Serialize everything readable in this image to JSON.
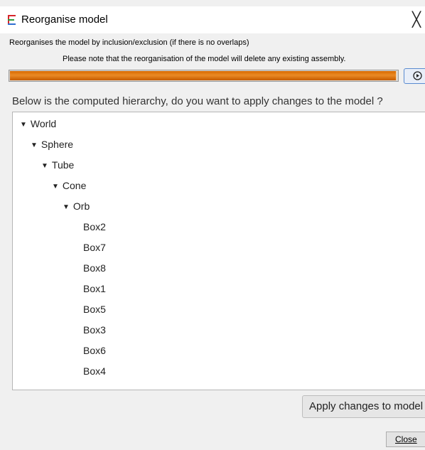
{
  "window": {
    "title": "Reorganise model",
    "close_glyph": "╳"
  },
  "description": {
    "line1": "Reorganises the model by inclusion/exclusion (if there is no overlaps)",
    "line2": "Please note that the reorganisation of the model will delete any existing assembly."
  },
  "progress": {
    "value": 1.0,
    "fill_color": "#e07b14"
  },
  "question": "Below is the computed hierarchy, do you want to apply changes to the model ?",
  "tree": {
    "expanded_arrow": "▼",
    "nodes": [
      {
        "label": "World",
        "level": 0,
        "expanded": true
      },
      {
        "label": "Sphere",
        "level": 1,
        "expanded": true
      },
      {
        "label": "Tube",
        "level": 2,
        "expanded": true
      },
      {
        "label": "Cone",
        "level": 3,
        "expanded": true
      },
      {
        "label": "Orb",
        "level": 4,
        "expanded": true
      },
      {
        "label": "Box2",
        "level": 5
      },
      {
        "label": "Box7",
        "level": 5
      },
      {
        "label": "Box8",
        "level": 5
      },
      {
        "label": "Box1",
        "level": 5
      },
      {
        "label": "Box5",
        "level": 5
      },
      {
        "label": "Box3",
        "level": 5
      },
      {
        "label": "Box6",
        "level": 5
      },
      {
        "label": "Box4",
        "level": 5
      }
    ]
  },
  "buttons": {
    "apply_label": "Apply changes to model",
    "close_label": "Close"
  },
  "icons": {
    "app": "app-e-icon",
    "run": "play-circle-icon",
    "window_close": "close-icon"
  }
}
